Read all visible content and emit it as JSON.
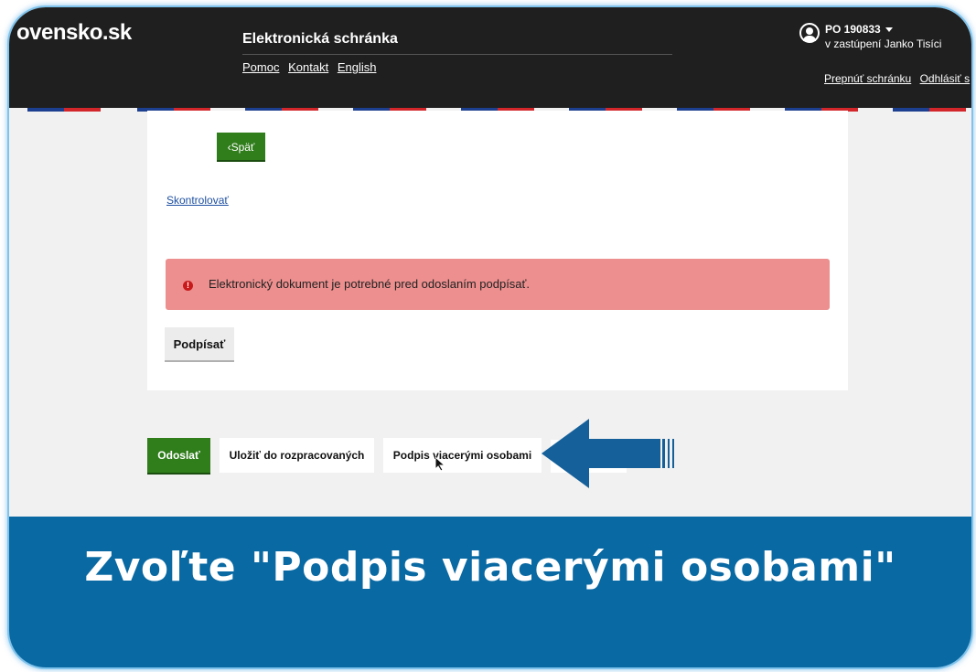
{
  "header": {
    "logo": "ovensko.sk",
    "app_title": "Elektronická schránka",
    "nav": [
      "Pomoc",
      "Kontakt",
      "English"
    ],
    "user_id": "PO 190833",
    "user_sub": "v zastúpení Janko Tisíci",
    "user_links": [
      "Prepnúť schránku",
      "Odhlásiť s"
    ]
  },
  "main": {
    "back_label": "Späť",
    "check_link": "Skontrolovať",
    "alert_text": "Elektronický dokument je potrebné pred odoslaním podpísať.",
    "sign_label": "Podpísať"
  },
  "actions": {
    "send_label": "Odoslať",
    "save_label": "Uložiť do rozpracovaných",
    "multi_label": "Podpis viacerými osobami"
  },
  "banner": {
    "text": "Zvoľte \"Podpis viacerými osobami\""
  },
  "colors": {
    "topbar": "#1f1f1f",
    "primary_green": "#2f7d1b",
    "alert_bg": "#ec8f8e",
    "banner_blue": "#0969a3",
    "arrow_blue": "#15609a"
  }
}
